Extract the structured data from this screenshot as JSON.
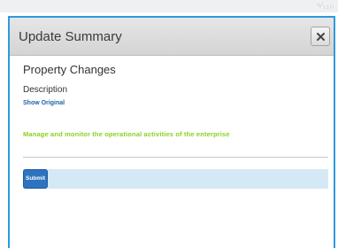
{
  "background": {
    "top_right_text": "ᵒ⁄₁₁ᵢᵢ",
    "strip_color": "#eef0f2"
  },
  "dialog": {
    "title": "Update Summary",
    "close_icon": "close-icon",
    "accent_color": "#2b9be0",
    "section_title": "Property Changes",
    "description_label": "Description",
    "show_original_link": "Show Original",
    "description_text": "Manage and monitor the operational activities of the enterprise",
    "description_color": "#8ccf1f",
    "submit_label": "Submit",
    "submit_color": "#2d73c0",
    "button_bar_color": "#d5e8f5"
  }
}
